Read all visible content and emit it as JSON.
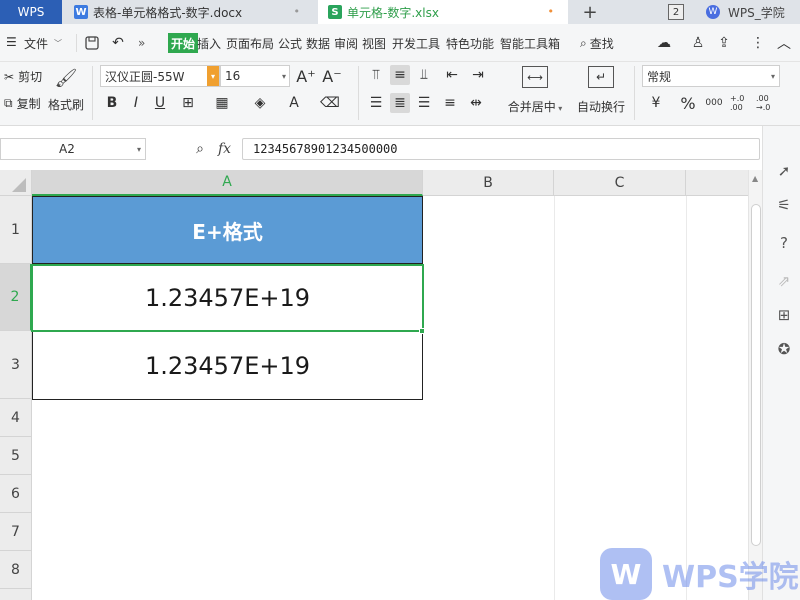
{
  "tabbar": {
    "home_label": "WPS",
    "doc_tab": {
      "icon_letter": "W",
      "label": "表格-单元格格式-数字.docx",
      "close": "•"
    },
    "xls_tab": {
      "icon_letter": "S",
      "label": "单元格-数字.xlsx",
      "close": "•"
    },
    "new_tab": "+",
    "tab_count": "2",
    "academy_logo": "W",
    "academy_label": "WPS_学院"
  },
  "menubar": {
    "file_label": "文件",
    "more": "»",
    "items": [
      "开始",
      "插入",
      "页面布局",
      "公式",
      "数据",
      "审阅",
      "视图",
      "开发工具",
      "特色功能",
      "智能工具箱"
    ],
    "active_item": "开始",
    "search_label": "查找"
  },
  "ribbon": {
    "cut": "剪切",
    "copy": "复制",
    "format_painter": "格式刷",
    "font_name": "汉仪正圆-55W",
    "font_size": "16",
    "merge_center": "合并居中",
    "wrap_text": "自动换行",
    "number_format": "常规",
    "bold": "B",
    "italic": "I",
    "underline": "U",
    "percent": "%",
    "thousands": "000",
    "inc_decimal": "+.0 .00",
    "dec_decimal": ".00 →.0"
  },
  "formula_bar": {
    "cell_ref": "A2",
    "fx_label": "fx",
    "value": "12345678901234500000"
  },
  "grid": {
    "columns": [
      "A",
      "B",
      "C"
    ],
    "selected_column": "A",
    "rows": [
      "1",
      "2",
      "3",
      "4",
      "5",
      "6",
      "7",
      "8"
    ],
    "selected_row": "2",
    "cells": {
      "A1": "E+格式",
      "A2": "1.23457E+19",
      "A3": "1.23457E+19"
    },
    "header_fill": "#5b9bd5",
    "selection_color": "#2fa84f"
  },
  "watermark": {
    "logo": "W",
    "text": "WPS学院"
  }
}
